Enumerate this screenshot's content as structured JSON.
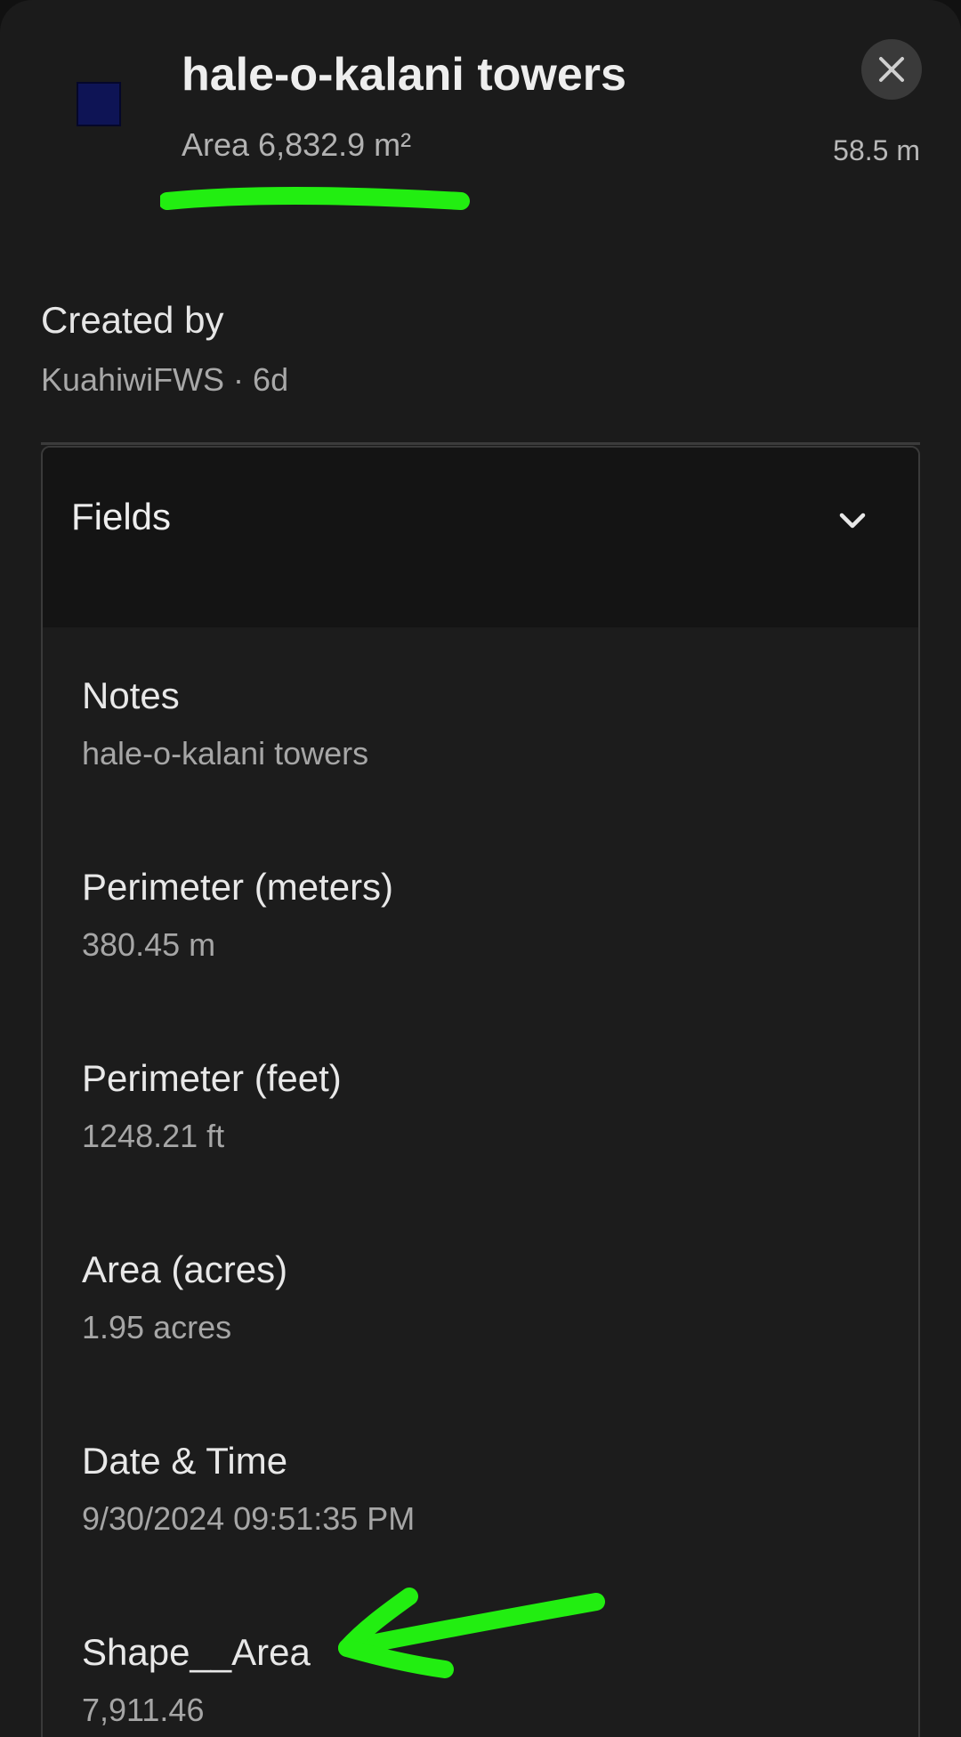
{
  "header": {
    "title": "hale-o-kalani towers",
    "subtitle": "Area 6,832.9 m²",
    "distance": "58.5 m",
    "swatch_color": "#0e1455",
    "close_icon": "close-icon"
  },
  "created": {
    "label": "Created by",
    "value": "KuahiwiFWS · 6d"
  },
  "fields": {
    "title": "Fields",
    "toggle_icon": "chevron-down-icon",
    "items": [
      {
        "label": "Notes",
        "value": "hale-o-kalani towers"
      },
      {
        "label": "Perimeter (meters)",
        "value": "380.45 m"
      },
      {
        "label": "Perimeter (feet)",
        "value": "1248.21 ft"
      },
      {
        "label": "Area (acres)",
        "value": "1.95 acres"
      },
      {
        "label": "Date & Time",
        "value": "9/30/2024 09:51:35 PM"
      },
      {
        "label": "Shape__Area",
        "value": "7,911.46"
      }
    ]
  },
  "annotation_color": "#22ee11"
}
